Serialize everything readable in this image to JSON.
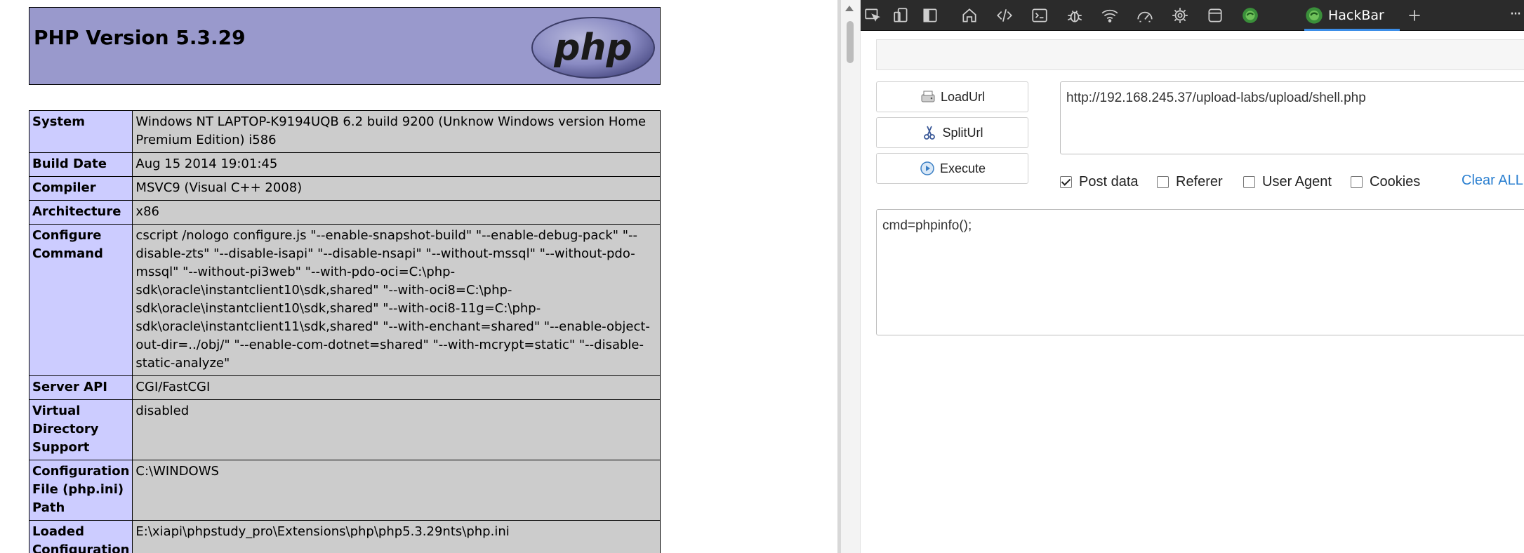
{
  "phpinfo": {
    "title": "PHP Version 5.3.29",
    "logo_text": "php",
    "rows": [
      {
        "label": "System",
        "value": "Windows NT LAPTOP-K9194UQB 6.2 build 9200 (Unknow Windows version Home Premium Edition) i586"
      },
      {
        "label": "Build Date",
        "value": "Aug 15 2014 19:01:45"
      },
      {
        "label": "Compiler",
        "value": "MSVC9 (Visual C++ 2008)"
      },
      {
        "label": "Architecture",
        "value": "x86"
      },
      {
        "label": "Configure Command",
        "value": "cscript /nologo configure.js \"--enable-snapshot-build\" \"--enable-debug-pack\" \"--disable-zts\" \"--disable-isapi\" \"--disable-nsapi\" \"--without-mssql\" \"--without-pdo-mssql\" \"--without-pi3web\" \"--with-pdo-oci=C:\\php-sdk\\oracle\\instantclient10\\sdk,shared\" \"--with-oci8=C:\\php-sdk\\oracle\\instantclient10\\sdk,shared\" \"--with-oci8-11g=C:\\php-sdk\\oracle\\instantclient11\\sdk,shared\" \"--with-enchant=shared\" \"--enable-object-out-dir=../obj/\" \"--enable-com-dotnet=shared\" \"--with-mcrypt=static\" \"--disable-static-analyze\""
      },
      {
        "label": "Server API",
        "value": "CGI/FastCGI"
      },
      {
        "label": "Virtual Directory Support",
        "value": "disabled"
      },
      {
        "label": "Configuration File (php.ini) Path",
        "value": "C:\\WINDOWS"
      },
      {
        "label": "Loaded Configuration",
        "value": "E:\\xiapi\\phpstudy_pro\\Extensions\\php\\php5.3.29nts\\php.ini"
      }
    ],
    "colors": {
      "header_bg": "#9999cc",
      "label_bg": "#ccccff",
      "value_bg": "#cccccc"
    }
  },
  "devtools": {
    "toolbar_icons": [
      "inspect-icon",
      "device-emulation-icon",
      "dock-side-icon",
      "home-icon",
      "code-icon",
      "console-icon",
      "bug-icon",
      "wifi-icon",
      "performance-icon",
      "cpu-icon",
      "application-icon",
      "hackbar-extension-icon"
    ],
    "active_tab": "HackBar",
    "more": "···",
    "accent": "#3c8ee8"
  },
  "hackbar": {
    "load_url": "LoadUrl",
    "split_url": "SplitUrl",
    "execute": "Execute",
    "url_value": "http://192.168.245.37/upload-labs/upload/shell.php",
    "options": {
      "post_data": "Post data",
      "referer": "Referer",
      "user_agent": "User Agent",
      "cookies": "Cookies"
    },
    "option_state": {
      "post_data": true,
      "referer": false,
      "user_agent": false,
      "cookies": false
    },
    "clear_all": "Clear ALL",
    "post_value": "cmd=phpinfo();",
    "link_color": "#2a7fd0"
  }
}
